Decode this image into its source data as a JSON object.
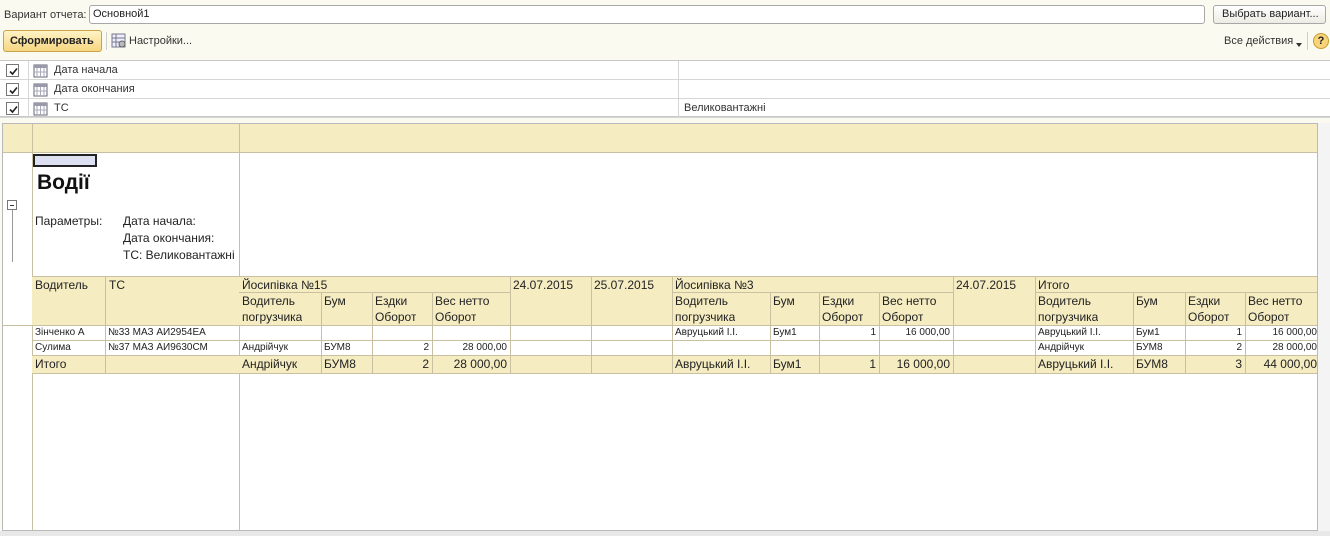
{
  "header": {
    "variant_label": "Вариант отчета:",
    "variant_value": "Основной1",
    "choose_variant": "Выбрать вариант...",
    "generate": "Сформировать",
    "settings": "Настройки...",
    "all_actions": "Все действия",
    "help": "?"
  },
  "params": [
    {
      "name": "Дата начала",
      "value": "",
      "checked": true
    },
    {
      "name": "Дата окончания",
      "value": "",
      "checked": true
    },
    {
      "name": "ТС",
      "value": "Великовантажні",
      "checked": true
    }
  ],
  "report": {
    "title": "Водії",
    "params_label": "Параметры:",
    "param_lines": [
      "Дата начала:",
      "Дата окончания:",
      "ТС: Великовантажні"
    ],
    "col_driver": "Водитель",
    "col_ts": "ТС",
    "group1": "Йосипівка №15",
    "date1": "24.07.2015",
    "date2": "25.07.2015",
    "group2": "Йосипівка №3",
    "date3": "24.07.2015",
    "group_total": "Итого",
    "sub_loader": [
      "Водитель",
      "погрузчика"
    ],
    "sub_bum": "Бум",
    "sub_trips": [
      "Ездки",
      "Оборот"
    ],
    "sub_weight": [
      "Вес нетто",
      "Оборот"
    ],
    "rows": [
      {
        "driver": "Зінченко А",
        "ts": "№33 МАЗ АИ2954ЕА",
        "g1": [
          "",
          "",
          "",
          ""
        ],
        "g2": [
          "Авруцький І.І.",
          "Бум1",
          "1",
          "16 000,00"
        ],
        "tot": [
          "Авруцький І.І.",
          "Бум1",
          "1",
          "16 000,00"
        ]
      },
      {
        "driver": "Сулима",
        "ts": "№37 МАЗ АИ9630СМ",
        "g1": [
          "Андрійчук",
          "БУМ8",
          "2",
          "28 000,00"
        ],
        "g2": [
          "",
          "",
          "",
          ""
        ],
        "tot": [
          "Андрійчук",
          "БУМ8",
          "2",
          "28 000,00"
        ]
      }
    ],
    "total": {
      "label": "Итого",
      "g1": [
        "Андрійчук",
        "БУМ8",
        "2",
        "28 000,00"
      ],
      "g2": [
        "Авруцький І.І.",
        "Бум1",
        "1",
        "16 000,00"
      ],
      "tot": [
        "Авруцький І.І.",
        "БУМ8",
        "3",
        "44 000,00"
      ]
    }
  }
}
